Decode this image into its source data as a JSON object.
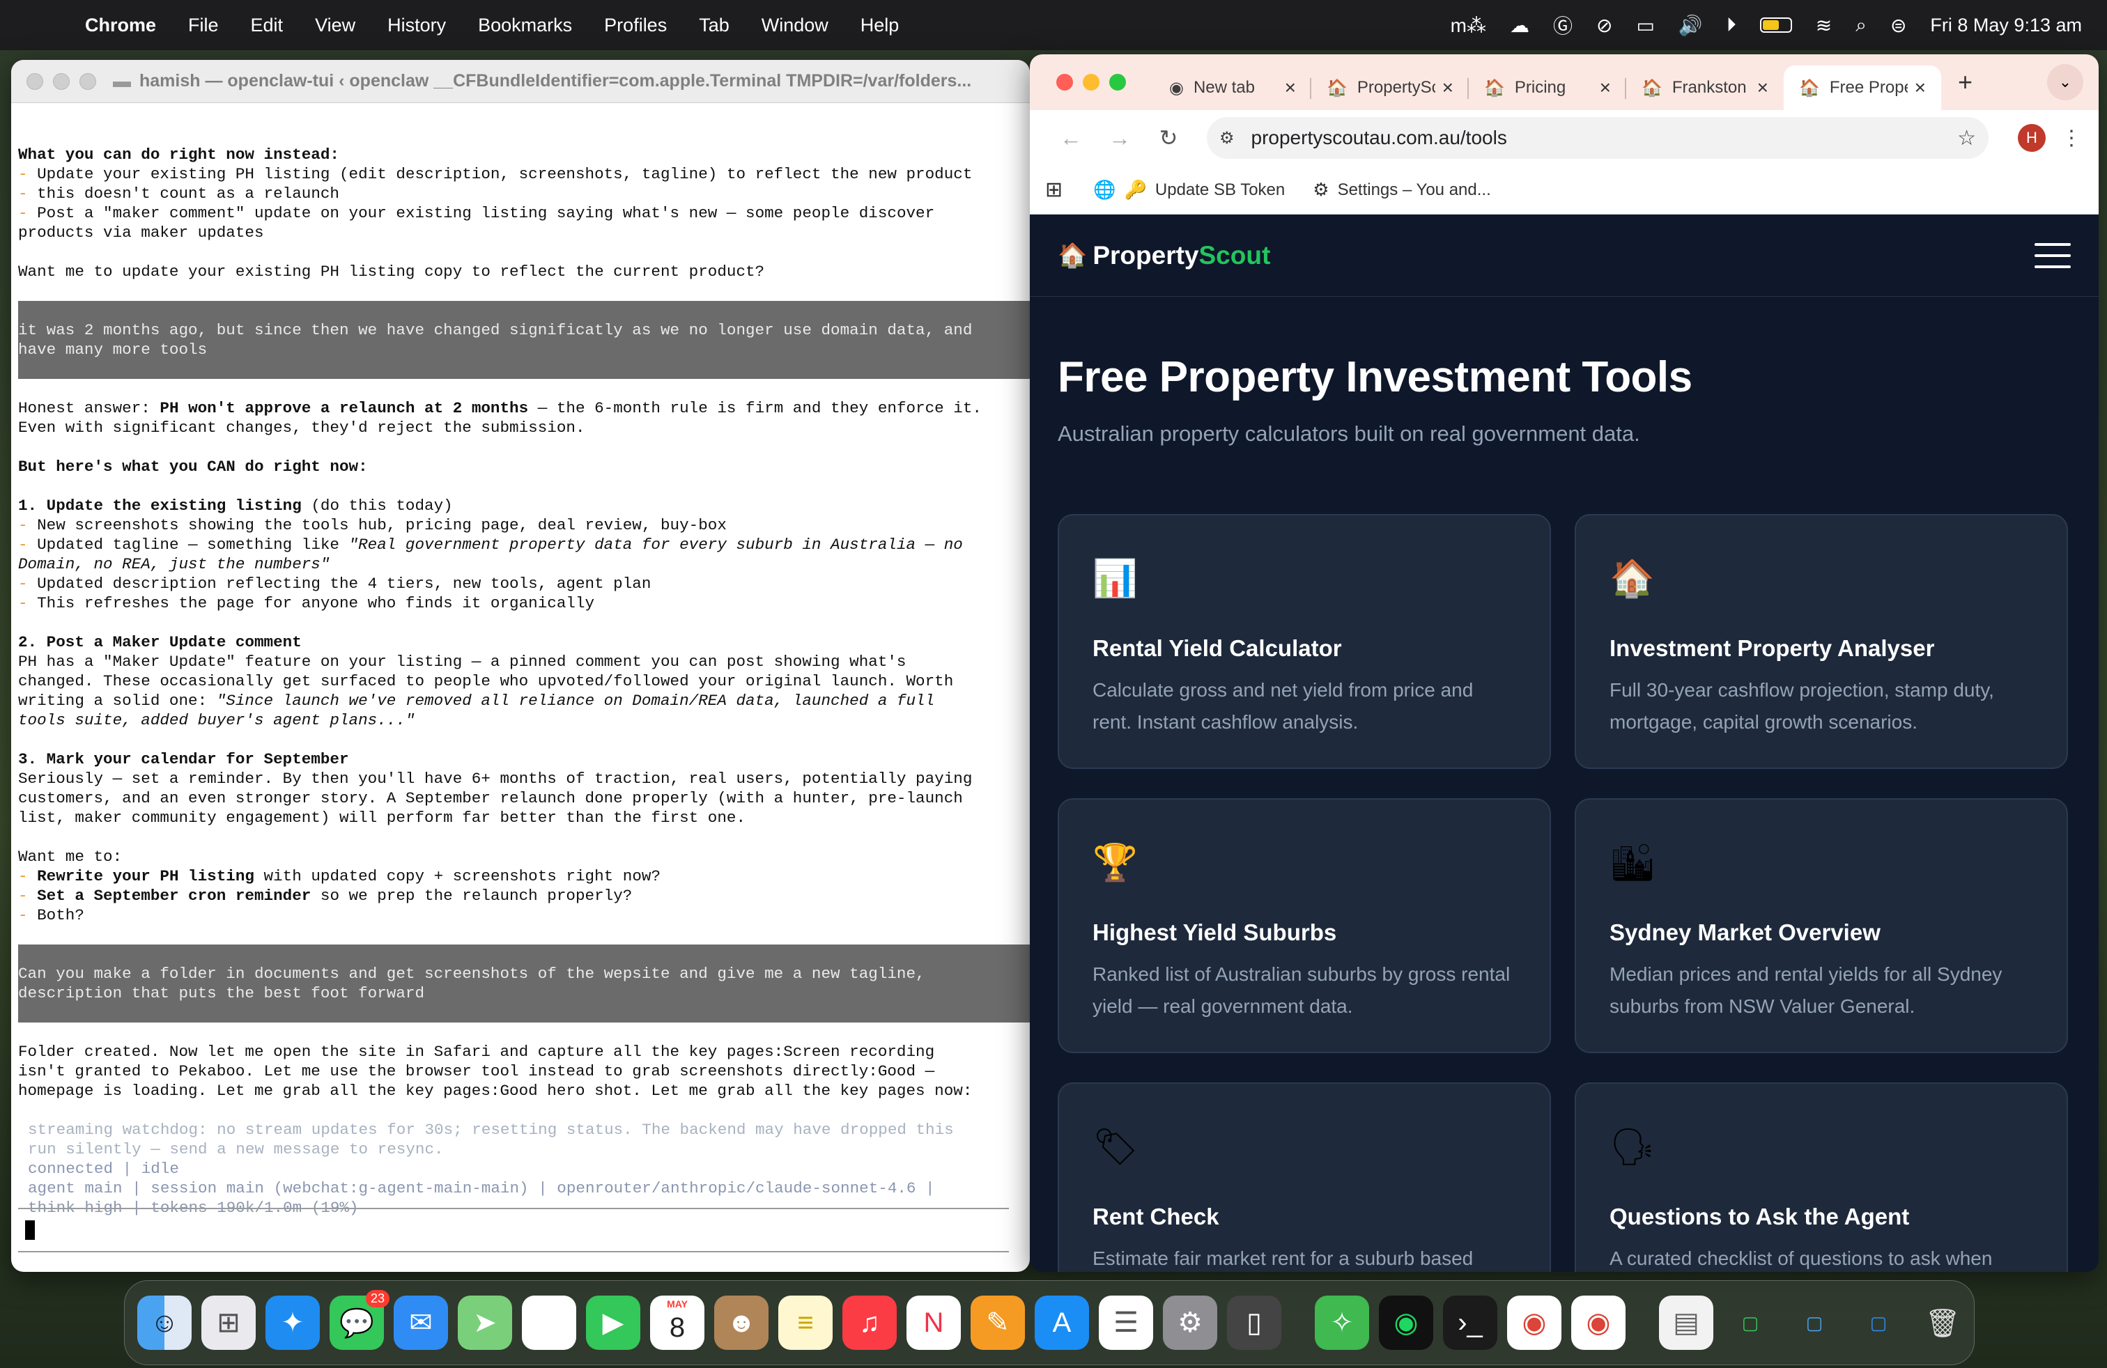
{
  "menubar": {
    "app": "Chrome",
    "items": [
      "File",
      "Edit",
      "View",
      "History",
      "Bookmarks",
      "Profiles",
      "Tab",
      "Window",
      "Help"
    ],
    "clock": "Fri 8 May  9:13 am",
    "battery_level": 0.6
  },
  "terminal": {
    "title": "hamish — openclaw-tui ‹ openclaw __CFBundleIdentifier=com.apple.Terminal TMPDIR=/var/folders...",
    "p1_head": "What you can do right now instead:",
    "p1_l1": " Update your existing PH listing (edit description, screenshots, tagline) to reflect the new product",
    "p1_l2": " this doesn't count as a relaunch",
    "p1_l3": " Post a \"maker comment\" update on your existing listing saying what's new — some people discover",
    "p1_l4": "products via maker updates",
    "p1_q": "Want me to update your existing PH listing copy to reflect the current product?",
    "user1_l1": "it was 2 months ago, but since then we have changed significatly as we no longer use domain data, and",
    "user1_l2": "have many more tools",
    "a_honest": "Honest answer: ",
    "a_honest_b": "PH won't approve a relaunch at 2 months",
    "a_honest_rest": " — the 6-month rule is firm and they enforce it.",
    "a_honest_l2": "Even with significant changes, they'd reject the submission.",
    "a_can": "But here's what you CAN do right now:",
    "s1_head": "1. Update the existing listing",
    "s1_head_rest": " (do this today)",
    "s1_l1": " New screenshots showing the tools hub, pricing page, deal review, buy-box",
    "s1_l2a": " Updated tagline — something like ",
    "s1_l2b": "\"Real government property data for every suburb in Australia — no",
    "s1_l3": "Domain, no REA, just the numbers\"",
    "s1_l4": " Updated description reflecting the 4 tiers, new tools, agent plan",
    "s1_l5": " This refreshes the page for anyone who finds it organically",
    "s2_head": "2. Post a Maker Update comment",
    "s2_l1": "PH has a \"Maker Update\" feature on your listing — a pinned comment you can post showing what's",
    "s2_l2": "changed. These occasionally get surfaced to people who upvoted/followed your original launch. Worth",
    "s2_l3a": "writing a solid one: ",
    "s2_l3b": "\"Since launch we've removed all reliance on Domain/REA data, launched a full",
    "s2_l4": "tools suite, added buyer's agent plans...\"",
    "s3_head": "3. Mark your calendar for September",
    "s3_l1": "Seriously — set a reminder. By then you'll have 6+ months of traction, real users, potentially paying",
    "s3_l2": "customers, and an even stronger story. A September relaunch done properly (with a hunter, pre-launch",
    "s3_l3": "list, maker community engagement) will perform far better than the first one.",
    "want": "Want me to:",
    "w1b": "Rewrite your PH listing",
    "w1r": " with updated copy + screenshots right now?",
    "w2b": "Set a September cron reminder",
    "w2r": " so we prep the relaunch properly?",
    "w3": " Both?",
    "user2_l1": "Can you make a folder in documents and get screenshots of the wepsite and give me a new tagline,",
    "user2_l2": "description that puts the best foot forward",
    "f_l1": "Folder created. Now let me open the site in Safari and capture all the key pages:Screen recording",
    "f_l2": "isn't granted to Pekaboo. Let me use the browser tool instead to grab screenshots directly:Good —",
    "f_l3": "homepage is loading. Let me grab all the key pages:Good hero shot. Let me grab all the key pages now:",
    "st_l1": "streaming watchdog: no stream updates for 30s; resetting status. The backend may have dropped this",
    "st_l2": "run silently — send a new message to resync.",
    "st_l3": "connected | idle",
    "st_l4": "agent main | session main (webchat:g-agent-main-main) | openrouter/anthropic/claude-sonnet-4.6 |",
    "st_l5": "think high | tokens 190k/1.0m (19%)"
  },
  "chrome": {
    "tabs": [
      {
        "label": "New tab",
        "icon": "chrome-icon"
      },
      {
        "label": "PropertyScout",
        "icon": "house-icon"
      },
      {
        "label": "Pricing",
        "icon": "house-icon"
      },
      {
        "label": "Frankston",
        "icon": "house-icon"
      },
      {
        "label": "Free Property",
        "icon": "house-icon"
      }
    ],
    "url": "propertyscoutau.com.au/tools",
    "avatar_initial": "H",
    "bookmarks": [
      "Update SB Token",
      "Settings – You and..."
    ]
  },
  "site": {
    "logo_a": "Property",
    "logo_b": "Scout",
    "title": "Free Property Investment Tools",
    "subtitle": "Australian property calculators built on real government data.",
    "cards": [
      {
        "icon": "📊",
        "title": "Rental Yield Calculator",
        "desc": "Calculate gross and net yield from price and rent. Instant cashflow analysis."
      },
      {
        "icon": "🏠",
        "title": "Investment Property Analyser",
        "desc": "Full 30-year cashflow projection, stamp duty, mortgage, capital growth scenarios."
      },
      {
        "icon": "🏆",
        "title": "Highest Yield Suburbs",
        "desc": "Ranked list of Australian suburbs by gross rental yield — real government data."
      },
      {
        "icon": "🏙",
        "title": "Sydney Market Overview",
        "desc": "Median prices and rental yields for all Sydney suburbs from NSW Valuer General."
      },
      {
        "icon": "🏷",
        "title": "Rent Check",
        "desc": "Estimate fair market rent for a suburb based"
      },
      {
        "icon": "🗣",
        "title": "Questions to Ask the Agent",
        "desc": "A curated checklist of questions to ask when"
      }
    ]
  },
  "dock": {
    "messages_badge": "23",
    "calendar_month": "MAY",
    "calendar_day": "8"
  }
}
